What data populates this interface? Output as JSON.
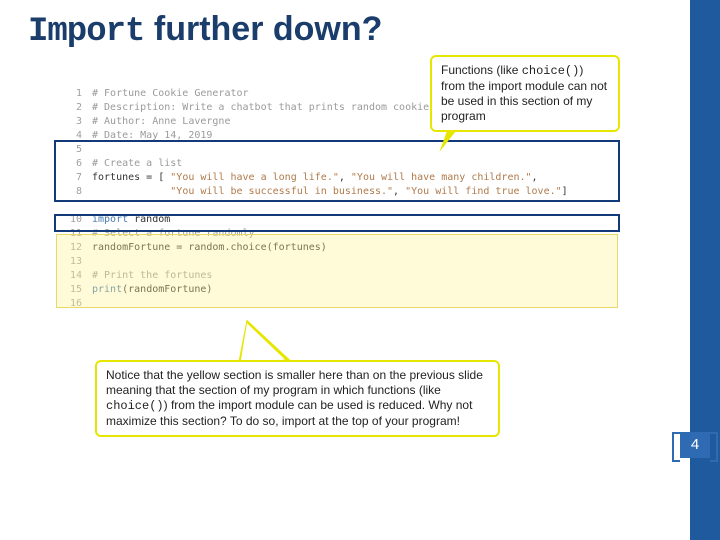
{
  "title": {
    "mono": "Import",
    "rest": " further down?"
  },
  "code": {
    "line_numbers": "1\n2\n3\n4\n5\n6\n7\n8\n\n10\n11\n12\n13\n14\n15\n16",
    "l1": "# Fortune Cookie Generator",
    "l2": "# Description: Write a chatbot that prints random cookie ",
    "l3": "# Author: Anne Lavergne",
    "l4": "# Date: May 14, 2019",
    "l5": "",
    "l6": "# Create a list",
    "l7a": "fortunes = [ ",
    "l7s1": "\"You will have a long life.\"",
    "l7c1": ", ",
    "l7s2": "\"You will have many children.\"",
    "l7c2": ", ",
    "l8s1": "\"You will be successful in business.\"",
    "l8c1": ", ",
    "l8s2": "\"You will find true love.\"",
    "l8c2": "]",
    "l9": "",
    "l10a": "import",
    "l10b": " random",
    "l11": "# Select a fortune randomly",
    "l12": "randomFortune = random.choice(fortunes)",
    "l13": "",
    "l14": "# Print the fortunes",
    "l15a": "print",
    "l15b": "(randomFortune)"
  },
  "callouts": {
    "top_prefix": "Functions (like ",
    "top_code": "choice()",
    "top_suffix": ") from the import module can not be used in this section of my program",
    "bottom_prefix": "Notice that the yellow section is smaller here than on the previous slide meaning that the section of my program in which functions (like ",
    "bottom_code": "choice()",
    "bottom_suffix": ") from the import module can be used is reduced. Why not maximize this section? To do so, import at the top of your program!"
  },
  "page_number": "4"
}
